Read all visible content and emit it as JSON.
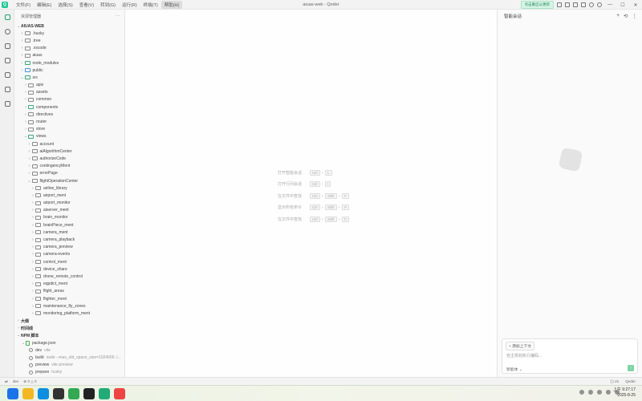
{
  "window": {
    "title": "aiuas-web - Qoder"
  },
  "menu": [
    "文件(F)",
    "编辑(E)",
    "选择(S)",
    "查看(V)",
    "转到(G)",
    "运行(R)",
    "终端(T)",
    "帮助(H)"
  ],
  "titlebar": {
    "update_badge": "点击重启以更新",
    "minimize": "—",
    "maximize": "☐",
    "close": "✕"
  },
  "explorer": {
    "header": "资源管理器",
    "more": "···",
    "root": "AIUAS-WEB",
    "items": [
      {
        "label": ".husky",
        "indent": 1,
        "kind": "folder",
        "open": false
      },
      {
        "label": ".tree",
        "indent": 1,
        "kind": "folder",
        "open": false
      },
      {
        "label": ".vscode",
        "indent": 1,
        "kind": "folder",
        "open": false
      },
      {
        "label": "aiuas",
        "indent": 1,
        "kind": "folder",
        "open": false
      },
      {
        "label": "node_modules",
        "indent": 1,
        "kind": "folder",
        "open": false,
        "color": "green"
      },
      {
        "label": "public",
        "indent": 1,
        "kind": "folder",
        "open": false,
        "color": "blue"
      },
      {
        "label": "src",
        "indent": 1,
        "kind": "folder",
        "open": true,
        "color": "green"
      },
      {
        "label": "apis",
        "indent": 2,
        "kind": "folder",
        "open": false
      },
      {
        "label": "assets",
        "indent": 2,
        "kind": "folder",
        "open": false
      },
      {
        "label": "common",
        "indent": 2,
        "kind": "folder",
        "open": false
      },
      {
        "label": "components",
        "indent": 2,
        "kind": "folder",
        "open": false,
        "color": "green"
      },
      {
        "label": "directives",
        "indent": 2,
        "kind": "folder",
        "open": false
      },
      {
        "label": "router",
        "indent": 2,
        "kind": "folder",
        "open": false
      },
      {
        "label": "store",
        "indent": 2,
        "kind": "folder",
        "open": false
      },
      {
        "label": "views",
        "indent": 2,
        "kind": "folder",
        "open": true,
        "color": "green"
      },
      {
        "label": "account",
        "indent": 3,
        "kind": "folder",
        "open": false
      },
      {
        "label": "aiAlgorithmCenter",
        "indent": 3,
        "kind": "folder",
        "open": false
      },
      {
        "label": "authorizeCode",
        "indent": 3,
        "kind": "folder",
        "open": false
      },
      {
        "label": "contingencyMent",
        "indent": 3,
        "kind": "folder",
        "open": false
      },
      {
        "label": "errorPage",
        "indent": 3,
        "kind": "folder",
        "open": false
      },
      {
        "label": "flightOperationCenter",
        "indent": 3,
        "kind": "folder",
        "open": true
      },
      {
        "label": "airline_library",
        "indent": 4,
        "kind": "folder",
        "open": false
      },
      {
        "label": "airport_ment",
        "indent": 4,
        "kind": "folder",
        "open": false
      },
      {
        "label": "airport_monitor",
        "indent": 4,
        "kind": "folder",
        "open": false
      },
      {
        "label": "aiserver_ment",
        "indent": 4,
        "kind": "folder",
        "open": false
      },
      {
        "label": "brain_monitor",
        "indent": 4,
        "kind": "folder",
        "open": false
      },
      {
        "label": "brainPiece_ment",
        "indent": 4,
        "kind": "folder",
        "open": false
      },
      {
        "label": "camera_ment",
        "indent": 4,
        "kind": "folder",
        "open": false
      },
      {
        "label": "camera_playback",
        "indent": 4,
        "kind": "folder",
        "open": false
      },
      {
        "label": "camera_preview",
        "indent": 4,
        "kind": "folder",
        "open": false
      },
      {
        "label": "camera-events",
        "indent": 4,
        "kind": "folder",
        "open": false
      },
      {
        "label": "control_ment",
        "indent": 4,
        "kind": "folder",
        "open": false
      },
      {
        "label": "device_share",
        "indent": 4,
        "kind": "folder",
        "open": false
      },
      {
        "label": "drone_remote_control",
        "indent": 4,
        "kind": "folder",
        "open": false
      },
      {
        "label": "eqpdict_ment",
        "indent": 4,
        "kind": "folder",
        "open": false
      },
      {
        "label": "flight_areas",
        "indent": 4,
        "kind": "folder",
        "open": false
      },
      {
        "label": "flighter_ment",
        "indent": 4,
        "kind": "folder",
        "open": false
      },
      {
        "label": "maintenance_fly_zones",
        "indent": 4,
        "kind": "folder",
        "open": false
      },
      {
        "label": "monitoring_platform_ment",
        "indent": 4,
        "kind": "folder",
        "open": false
      }
    ],
    "sections": [
      "大纲",
      "时间线",
      "NPM 脚本"
    ],
    "npm": {
      "package": "package.json",
      "scripts": [
        {
          "name": "dev",
          "cmd": "vite"
        },
        {
          "name": "build",
          "cmd": "node --max_old_space_size=1024000 ./..."
        },
        {
          "name": "preview",
          "cmd": "vite preview"
        },
        {
          "name": "prepare",
          "cmd": "husky"
        }
      ]
    }
  },
  "editor": {
    "shortcuts": [
      {
        "label": "打开智能会话",
        "keys": [
          "Ctrl",
          "L"
        ]
      },
      {
        "label": "打开行间会话",
        "keys": [
          "Ctrl",
          "I"
        ]
      },
      {
        "label": "在文件中查找",
        "keys": [
          "Ctrl",
          "Shift",
          "F"
        ]
      },
      {
        "label": "显示所有命令",
        "keys": [
          "Ctrl",
          "Shift",
          "P"
        ]
      },
      {
        "label": "在文件中查找",
        "keys": [
          "Ctrl",
          "Shift",
          "F"
        ]
      }
    ]
  },
  "chat": {
    "title": "智能会话",
    "add_context": "+ 添加上下文",
    "placeholder": "自主规划执行编码...",
    "mode": "智能体 ⌄",
    "send": "↑"
  },
  "statusbar": {
    "branch": "dev",
    "problems": "⊗ 0 △ 0",
    "right": [
      "{ } 21",
      "Qoder"
    ]
  },
  "taskbar": {
    "time": "上午 9:27:17",
    "date": "2025-8-25",
    "apps": [
      {
        "name": "start",
        "color": "#1a73e8"
      },
      {
        "name": "files",
        "color": "#f2b824"
      },
      {
        "name": "edge",
        "color": "#0e8ee0"
      },
      {
        "name": "terminal",
        "color": "#333333"
      },
      {
        "name": "chrome",
        "color": "#34a853"
      },
      {
        "name": "qoder",
        "color": "#222222"
      },
      {
        "name": "app",
        "color": "#2a7"
      },
      {
        "name": "app2",
        "color": "#e44"
      }
    ]
  }
}
